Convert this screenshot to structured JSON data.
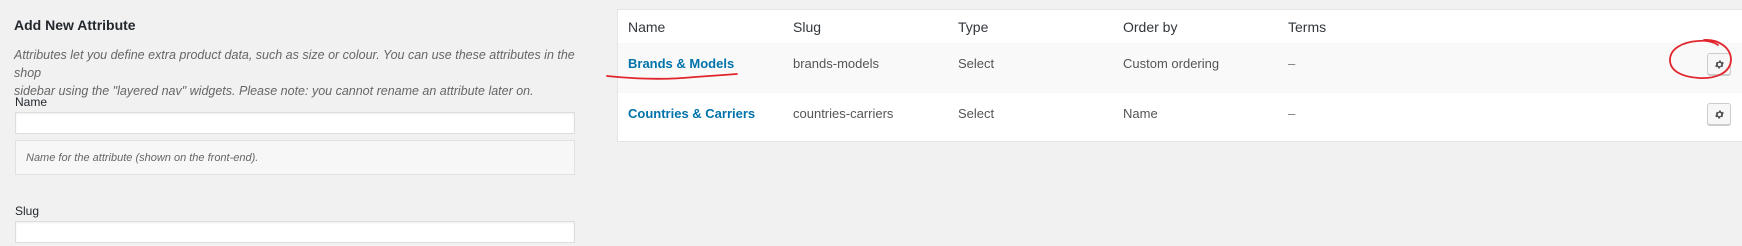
{
  "form": {
    "title": "Add New Attribute",
    "description_line1": "Attributes let you define extra product data, such as size or colour. You can use these attributes in the shop",
    "description_line2": "sidebar using the \"layered nav\" widgets. Please note: you cannot rename an attribute later on.",
    "name_label": "Name",
    "name_value": "",
    "name_hint": "Name for the attribute (shown on the front-end).",
    "slug_label": "Slug",
    "slug_value": ""
  },
  "table": {
    "columns": [
      "Name",
      "Slug",
      "Type",
      "Order by",
      "Terms"
    ],
    "rows": [
      {
        "name": "Brands & Models",
        "slug": "brands-models",
        "type": "Select",
        "order_by": "Custom ordering",
        "terms": "–",
        "action_icon": "gear-icon"
      },
      {
        "name": "Countries & Carriers",
        "slug": "countries-carriers",
        "type": "Select",
        "order_by": "Name",
        "terms": "–",
        "action_icon": "gear-icon"
      }
    ]
  },
  "colors": {
    "link": "#0073aa",
    "annotation": "#e0262c",
    "background": "#f1f1f1"
  }
}
